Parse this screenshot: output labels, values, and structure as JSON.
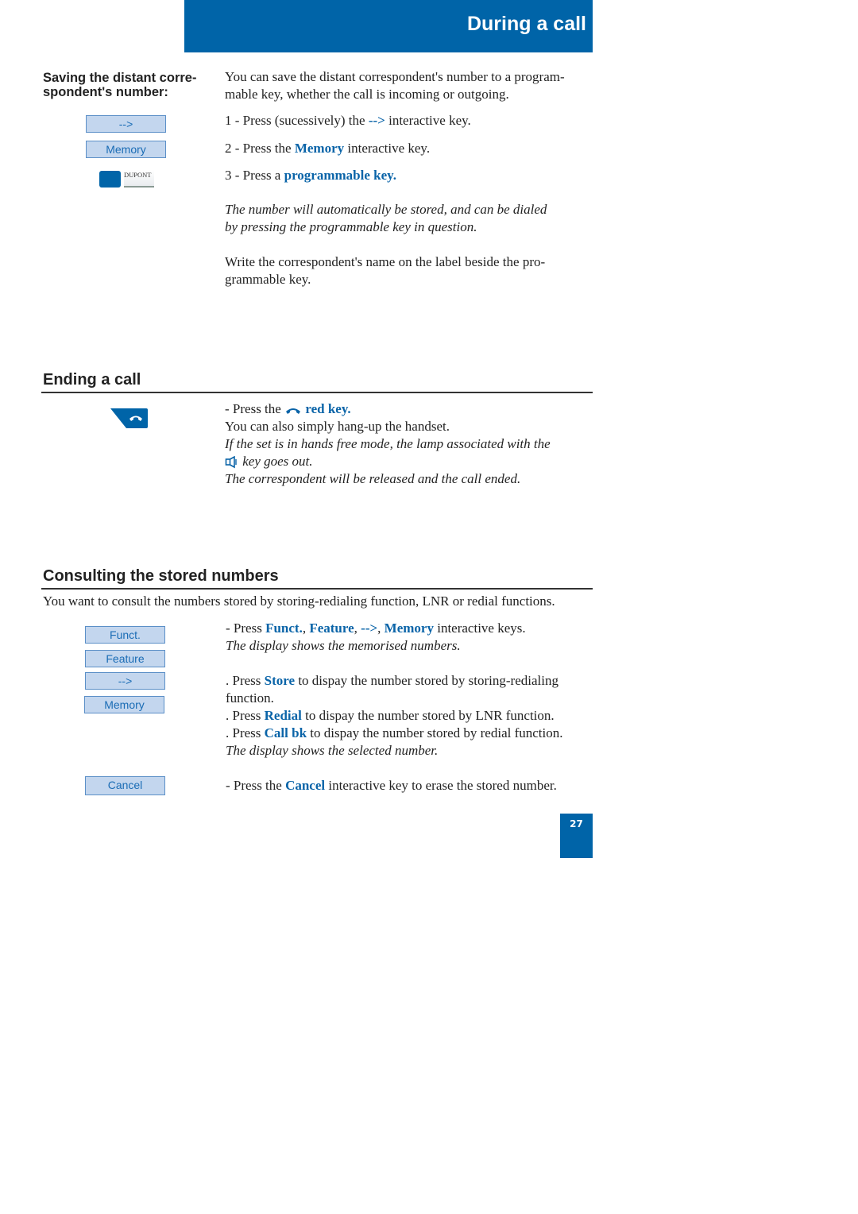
{
  "header": {
    "title": "During a call",
    "accent_color": "#0064a8"
  },
  "saving": {
    "side_heading": "Saving the distant correspondent's number:",
    "side_heading_line1": "Saving the distant corre-",
    "side_heading_line2": "spondent's number:",
    "keys": [
      "-->",
      "Memory"
    ],
    "prog_key_label": "DUPONT",
    "intro_line1": "You can save the distant correspondent's number to a program-",
    "intro_line2": "mable key, whether the call is incoming or outgoing.",
    "step1_pre": "1 - Press (sucessively) the ",
    "step1_kw": "-->",
    "step1_post": " interactive key.",
    "step2_pre": "2 - Press the ",
    "step2_kw": "Memory",
    "step2_post": " interactive key.",
    "step3_pre": "3 - Press a ",
    "step3_kw": "programmable key.",
    "note_line1": "The number will automatically be stored, and can be dialed",
    "note_line2": "by pressing the programmable key in question.",
    "write_line1": "Write the correspondent's name on the label beside the pro-",
    "write_line2": "grammable key."
  },
  "ending": {
    "heading": "Ending a call",
    "icon": "hang-up-red-key-icon",
    "line1_pre": "- Press the ",
    "line1_kw": "red key.",
    "line2": "You can also simply hang-up the handset.",
    "line3": "If the set is in hands free mode, the lamp associated with the",
    "line4": " key goes out.",
    "line4_icon": "loudspeaker-icon",
    "line5": "The correspondent will be released and the call ended."
  },
  "consulting": {
    "heading": "Consulting the stored numbers",
    "intro": "You want to consult the numbers stored by storing-redialing function, LNR or redial functions.",
    "keys": [
      "Funct.",
      "Feature",
      "-->",
      "Memory"
    ],
    "cancel_key": "Cancel",
    "press_pre": "- Press ",
    "press_kw1": "Funct.",
    "press_sep1": ", ",
    "press_kw2": "Feature",
    "press_sep2": ", ",
    "press_kw3": "-->",
    "press_sep3": ", ",
    "press_kw4": "Memory",
    "press_post": " interactive keys.",
    "display_memorised": "The display shows the memorised numbers.",
    "store_pre": ". Press ",
    "store_kw": "Store",
    "store_post": " to dispay the number stored by storing-redialing",
    "store_post2": "function.",
    "redial_pre": ". Press ",
    "redial_kw": "Redial",
    "redial_post": " to dispay the number stored by LNR function.",
    "callbk_pre": ". Press ",
    "callbk_kw": "Call bk",
    "callbk_post": " to dispay the number stored by redial function.",
    "display_selected": "The display shows the selected number.",
    "cancel_pre": "- Press the ",
    "cancel_kw": "Cancel",
    "cancel_post": " interactive key to erase the stored number."
  },
  "footer": {
    "page_number": "27"
  }
}
